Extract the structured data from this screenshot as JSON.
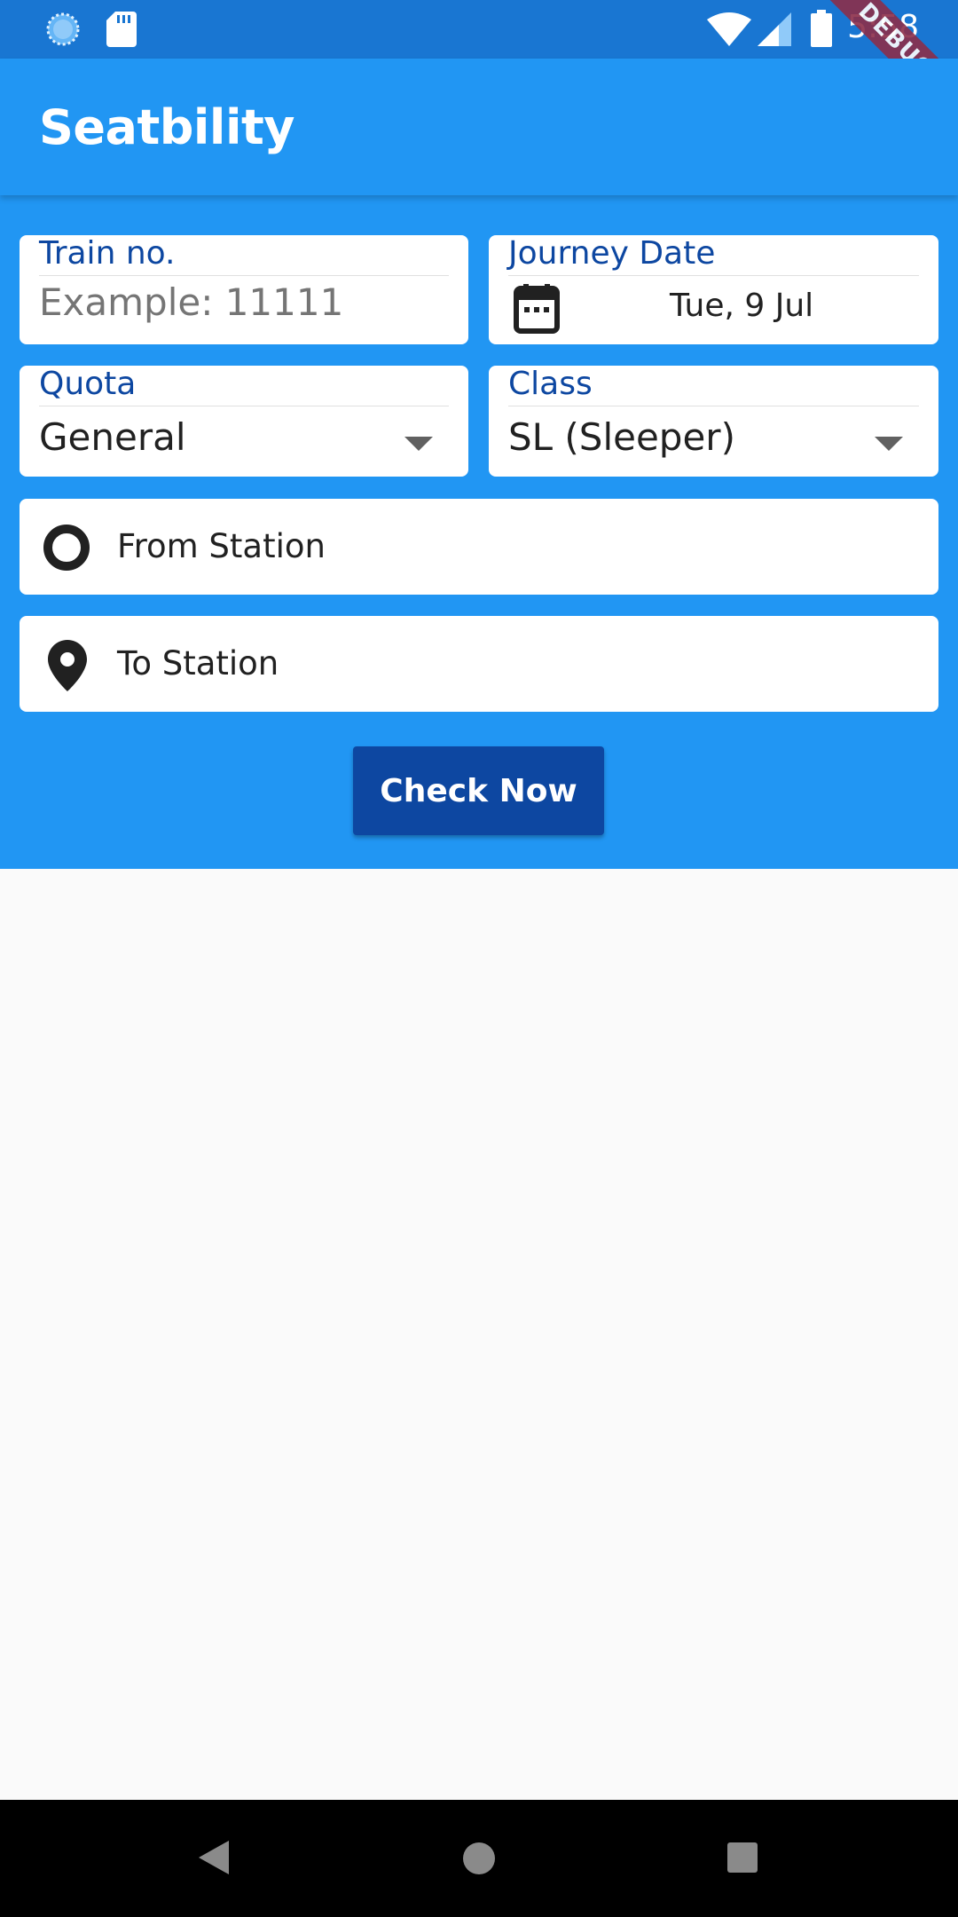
{
  "status_bar": {
    "time": "5:58",
    "debug_label": "DEBUG",
    "icons": [
      "sync-circle-icon",
      "sd-card-icon",
      "wifi-icon",
      "cell-signal-icon",
      "battery-icon"
    ]
  },
  "app_bar": {
    "title": "Seatbility"
  },
  "form": {
    "train_no": {
      "label": "Train no.",
      "placeholder": "Example: 11111"
    },
    "journey_date": {
      "label": "Journey Date",
      "value": "Tue, 9 Jul",
      "icon": "calendar-icon"
    },
    "quota": {
      "label": "Quota",
      "value": "General",
      "icon": "dropdown-arrow-icon"
    },
    "class": {
      "label": "Class",
      "value": "SL (Sleeper)",
      "icon": "dropdown-arrow-icon"
    },
    "from_station": {
      "label": "From Station",
      "icon": "circle-outline-icon"
    },
    "to_station": {
      "label": "To Station",
      "icon": "location-pin-icon"
    },
    "check_button": {
      "label": "Check Now"
    }
  },
  "nav_bar": {
    "icons": [
      "back-icon",
      "home-icon",
      "recents-icon"
    ]
  },
  "colors": {
    "status_bar": "#1976d2",
    "primary": "#2196f3",
    "accent_dark": "#0d47a1",
    "background": "#fafafa",
    "debug_banner": "#8c2e4a"
  }
}
